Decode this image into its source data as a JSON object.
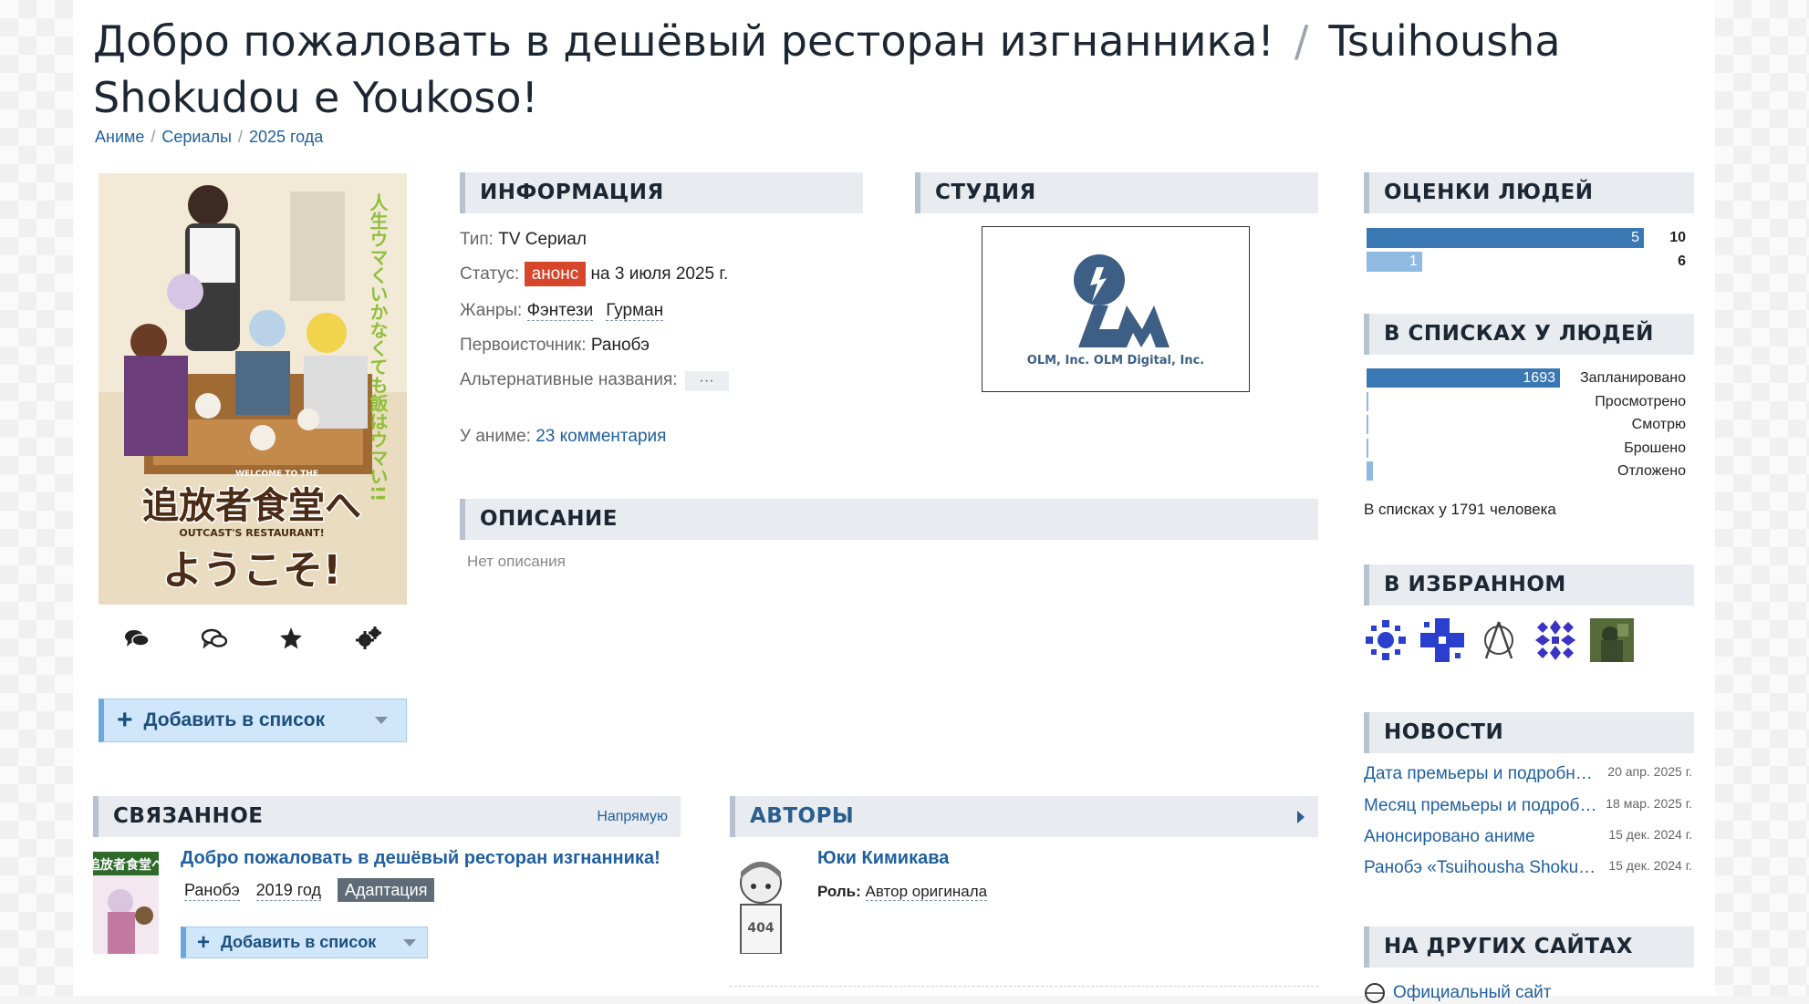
{
  "title": {
    "ru": "Добро пожаловать в дешёвый ресторан изгнанника!",
    "sep": "/",
    "en": "Tsuihousha Shokudou e Youkoso!"
  },
  "breadcrumbs": [
    {
      "label": "Аниме"
    },
    {
      "label": "Сериалы"
    },
    {
      "label": "2025 года"
    }
  ],
  "breadcrumb_sep": "/",
  "poster": {
    "jp_vertical": "人生ウマくいかなくても飯はウマい!!",
    "jp_title": "追放者食堂へ",
    "jp_title2": "ようこそ!",
    "en_sub": "OUTCAST'S RESTAURANT!",
    "welcome": "WELCOME TO THE"
  },
  "actions": [
    {
      "icon": "comments-icon"
    },
    {
      "icon": "discussion-icon"
    },
    {
      "icon": "star-icon"
    },
    {
      "icon": "gears-icon"
    }
  ],
  "add_to_list": {
    "label": "Добавить в список"
  },
  "info": {
    "heading": "ИНФОРМАЦИЯ",
    "type_label": "Тип:",
    "type_value": "TV Сериал",
    "status_label": "Статус:",
    "status_badge": "анонс",
    "status_date": "на 3 июля 2025 г.",
    "genres_label": "Жанры:",
    "genres": [
      "Фэнтези",
      "Гурман"
    ],
    "source_label": "Первоисточник:",
    "source_value": "Ранобэ",
    "alt_label": "Альтернативные названия:",
    "alt_more": "···",
    "comments_label": "У аниме:",
    "comments_link": "23 комментария"
  },
  "studio": {
    "heading": "СТУДИЯ",
    "logo_text": "OLM, Inc.  OLM Digital, Inc."
  },
  "description": {
    "heading": "ОПИСАНИЕ",
    "text": "Нет описания"
  },
  "ratings": {
    "heading": "ОЦЕНКИ ЛЮДЕЙ",
    "rows": [
      {
        "score": "10",
        "count": "5",
        "fraction": 1.0
      },
      {
        "score": "6",
        "count": "1",
        "fraction": 0.2
      }
    ]
  },
  "lists": {
    "heading": "В СПИСКАХ У ЛЮДЕЙ",
    "rows": [
      {
        "label": "Запланировано",
        "count": "1693",
        "fraction": 1.0
      },
      {
        "label": "Просмотрено",
        "count": "",
        "fraction": 0.004
      },
      {
        "label": "Смотрю",
        "count": "",
        "fraction": 0.01
      },
      {
        "label": "Брошено",
        "count": "",
        "fraction": 0.01
      },
      {
        "label": "Отложено",
        "count": "",
        "fraction": 0.035
      }
    ],
    "total": "В списках у 1791 человека"
  },
  "favorites": {
    "heading": "В ИЗБРАННОМ",
    "avatars": [
      "avatar-1",
      "avatar-2",
      "avatar-3",
      "avatar-4",
      "avatar-5"
    ]
  },
  "news": {
    "heading": "НОВОСТИ",
    "items": [
      {
        "title": "Дата премьеры и подробности",
        "date": "20 апр. 2025 г."
      },
      {
        "title": "Месяц премьеры и подробности",
        "date": "18 мар. 2025 г."
      },
      {
        "title": "Анонсировано аниме",
        "date": "15 дек. 2024 г."
      },
      {
        "title": "Ранобэ «Tsuihousha Shokudou e Youkoso!»",
        "date": "15 дек. 2024 г."
      }
    ]
  },
  "other_sites": {
    "heading": "НА ДРУГИХ САЙТАХ",
    "first": "Официальный сайт"
  },
  "related": {
    "heading": "СВЯЗАННОЕ",
    "aside": "Напрямую",
    "item": {
      "title": "Добро пожаловать в дешёвый ресторан изгнанника!",
      "kind": "Ранобэ",
      "year": "2019 год",
      "relation": "Адаптация",
      "add_label": "Добавить в список"
    }
  },
  "authors": {
    "heading": "АВТОРЫ",
    "name": "Юки Кимикава",
    "role_label": "Роль:",
    "role_value": "Автор оригинала"
  },
  "colors": {
    "accent": "#3a78b4",
    "status_badge": "#d7452b",
    "link": "#1f5f9e"
  }
}
